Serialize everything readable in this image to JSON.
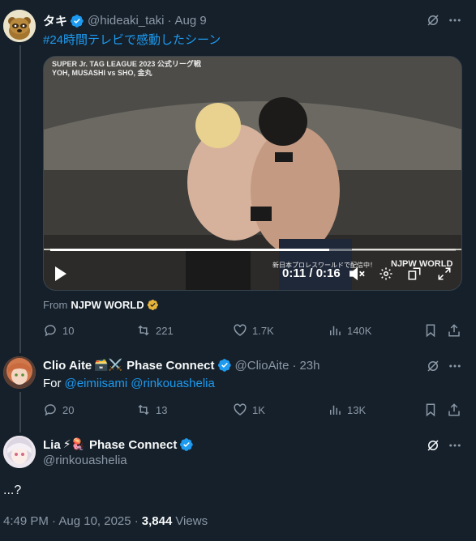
{
  "tweet1": {
    "display_name": "タキ",
    "handle": "@hideaki_taki",
    "separator": "·",
    "date": "Aug 9",
    "text": "#24時間テレビで感動したシーン",
    "video": {
      "overlay_top_line1": "SUPER Jr. TAG LEAGUE 2023 公式リーグ戦",
      "overlay_top_line2": "YOH, MUSASHI vs SHO, 金丸",
      "overlay_bottom_jp": "新日本プロレスワールドで配信中！",
      "overlay_logo": "NJPW WORLD",
      "time": "0:11 / 0:16",
      "progress": 0.6875
    },
    "source_prefix": "From",
    "source_name": "NJPW WORLD",
    "actions": {
      "replies": "10",
      "retweets": "221",
      "likes": "1.7K",
      "views": "140K"
    }
  },
  "tweet2": {
    "display_name": "Clio Aite",
    "name_emojis": "🗃️⚔️",
    "affiliation": "Phase Connect",
    "handle": "@ClioAite",
    "separator": "·",
    "date": "23h",
    "text_prefix": "For",
    "mention1": "@eimiisami",
    "mention2": "@rinkouashelia",
    "actions": {
      "replies": "20",
      "retweets": "13",
      "likes": "1K",
      "views": "13K"
    }
  },
  "tweet3": {
    "display_name": "Lia",
    "name_emojis": "⚡🪼",
    "affiliation": "Phase Connect",
    "handle": "@rinkouashelia",
    "text": "...?",
    "timestamp": "4:49 PM · Aug 10, 2025 ·",
    "views_count": "3,844",
    "views_label": "Views"
  },
  "colors": {
    "background": "#15202b",
    "accent": "#1d9bf0",
    "muted": "#8b98a5",
    "divider": "#38444d",
    "gold_badge": "#e8b339"
  }
}
